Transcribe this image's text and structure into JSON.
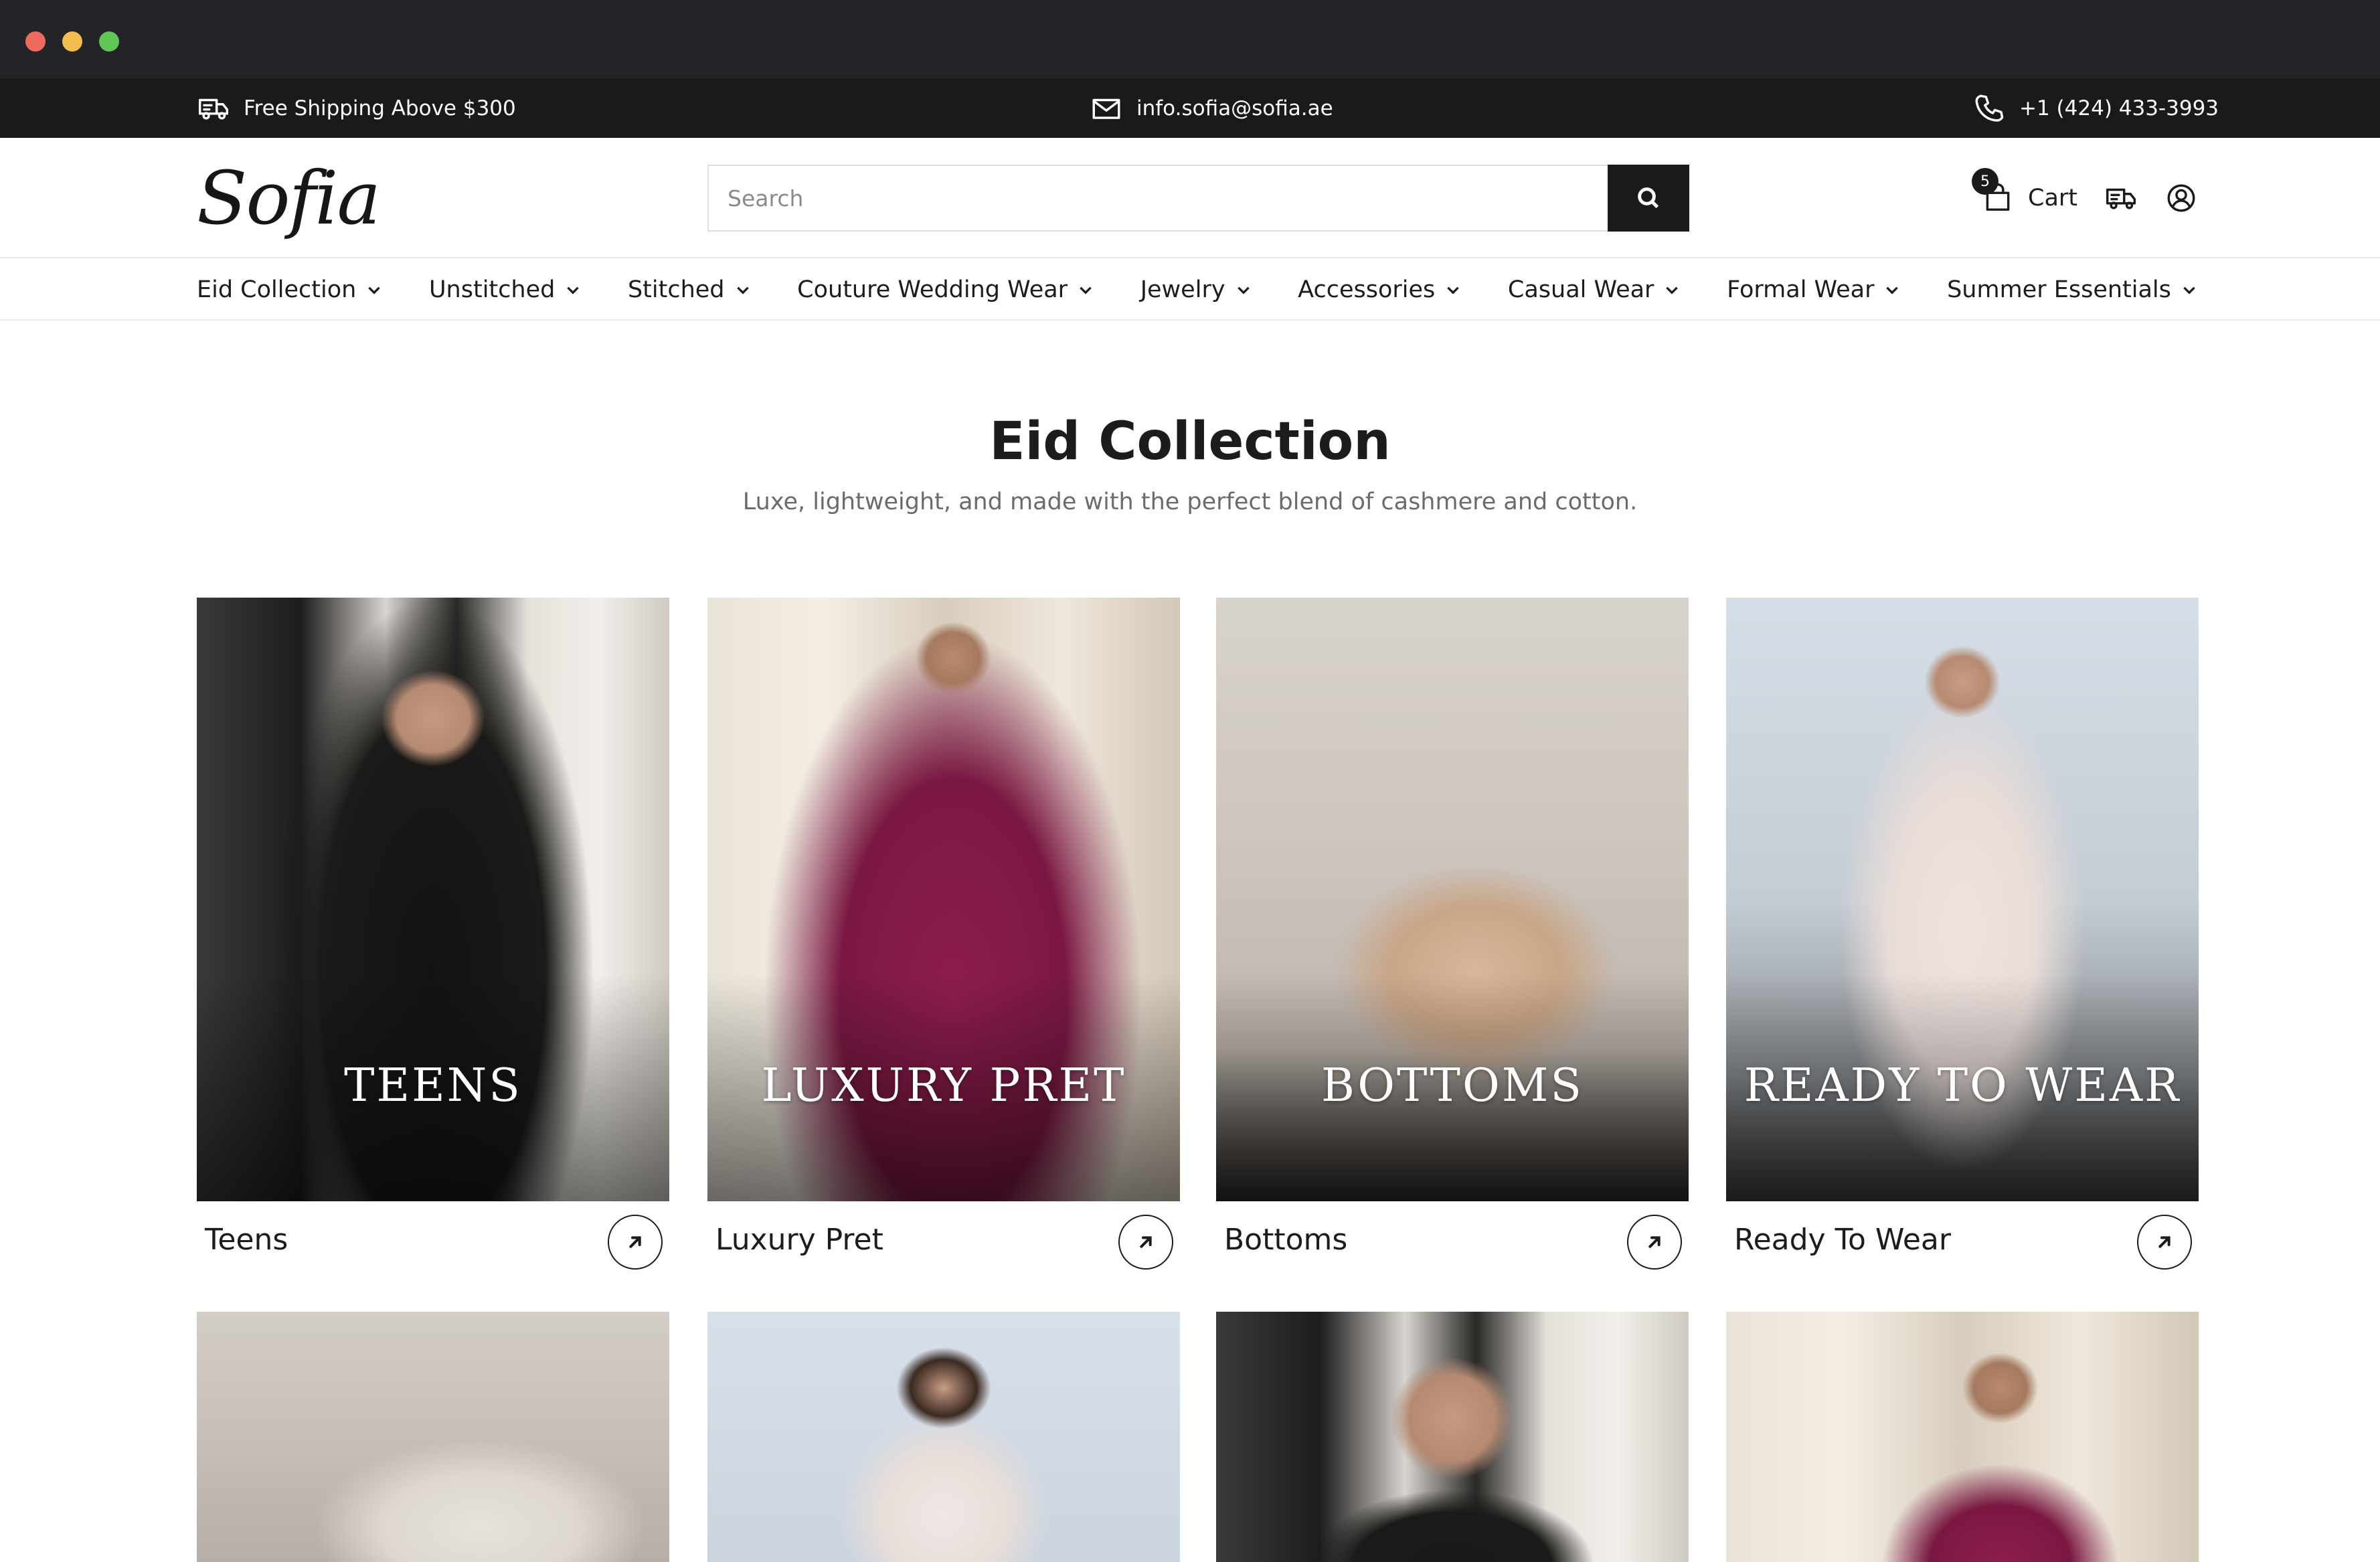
{
  "announcement": {
    "shipping": "Free Shipping Above $300",
    "email": "info.sofia@sofia.ae",
    "phone": "+1 (424) 433-3993"
  },
  "header": {
    "logo": "Sofia",
    "search_placeholder": "Search",
    "cart_label": "Cart",
    "cart_count": "5"
  },
  "nav": [
    {
      "label": "Eid Collection"
    },
    {
      "label": "Unstitched"
    },
    {
      "label": "Stitched"
    },
    {
      "label": "Couture Wedding Wear"
    },
    {
      "label": "Jewelry"
    },
    {
      "label": "Accessories"
    },
    {
      "label": "Casual Wear"
    },
    {
      "label": "Formal Wear"
    },
    {
      "label": "Summer Essentials"
    }
  ],
  "section": {
    "title": "Eid Collection",
    "subtitle": "Luxe, lightweight, and made with the perfect blend of cashmere and cotton."
  },
  "cards": [
    {
      "name": "Teens",
      "overlay": "TEENS"
    },
    {
      "name": "Luxury Pret",
      "overlay": "LUXURY PRET"
    },
    {
      "name": "Bottoms",
      "overlay": "BOTTOMS"
    },
    {
      "name": "Ready To Wear",
      "overlay": "READY TO WEAR"
    }
  ],
  "colors": {
    "titlebar": "#232427",
    "topbar": "#1a1a1a",
    "accent": "#1a1a1a",
    "subtitle_text": "#6b6b6b"
  }
}
